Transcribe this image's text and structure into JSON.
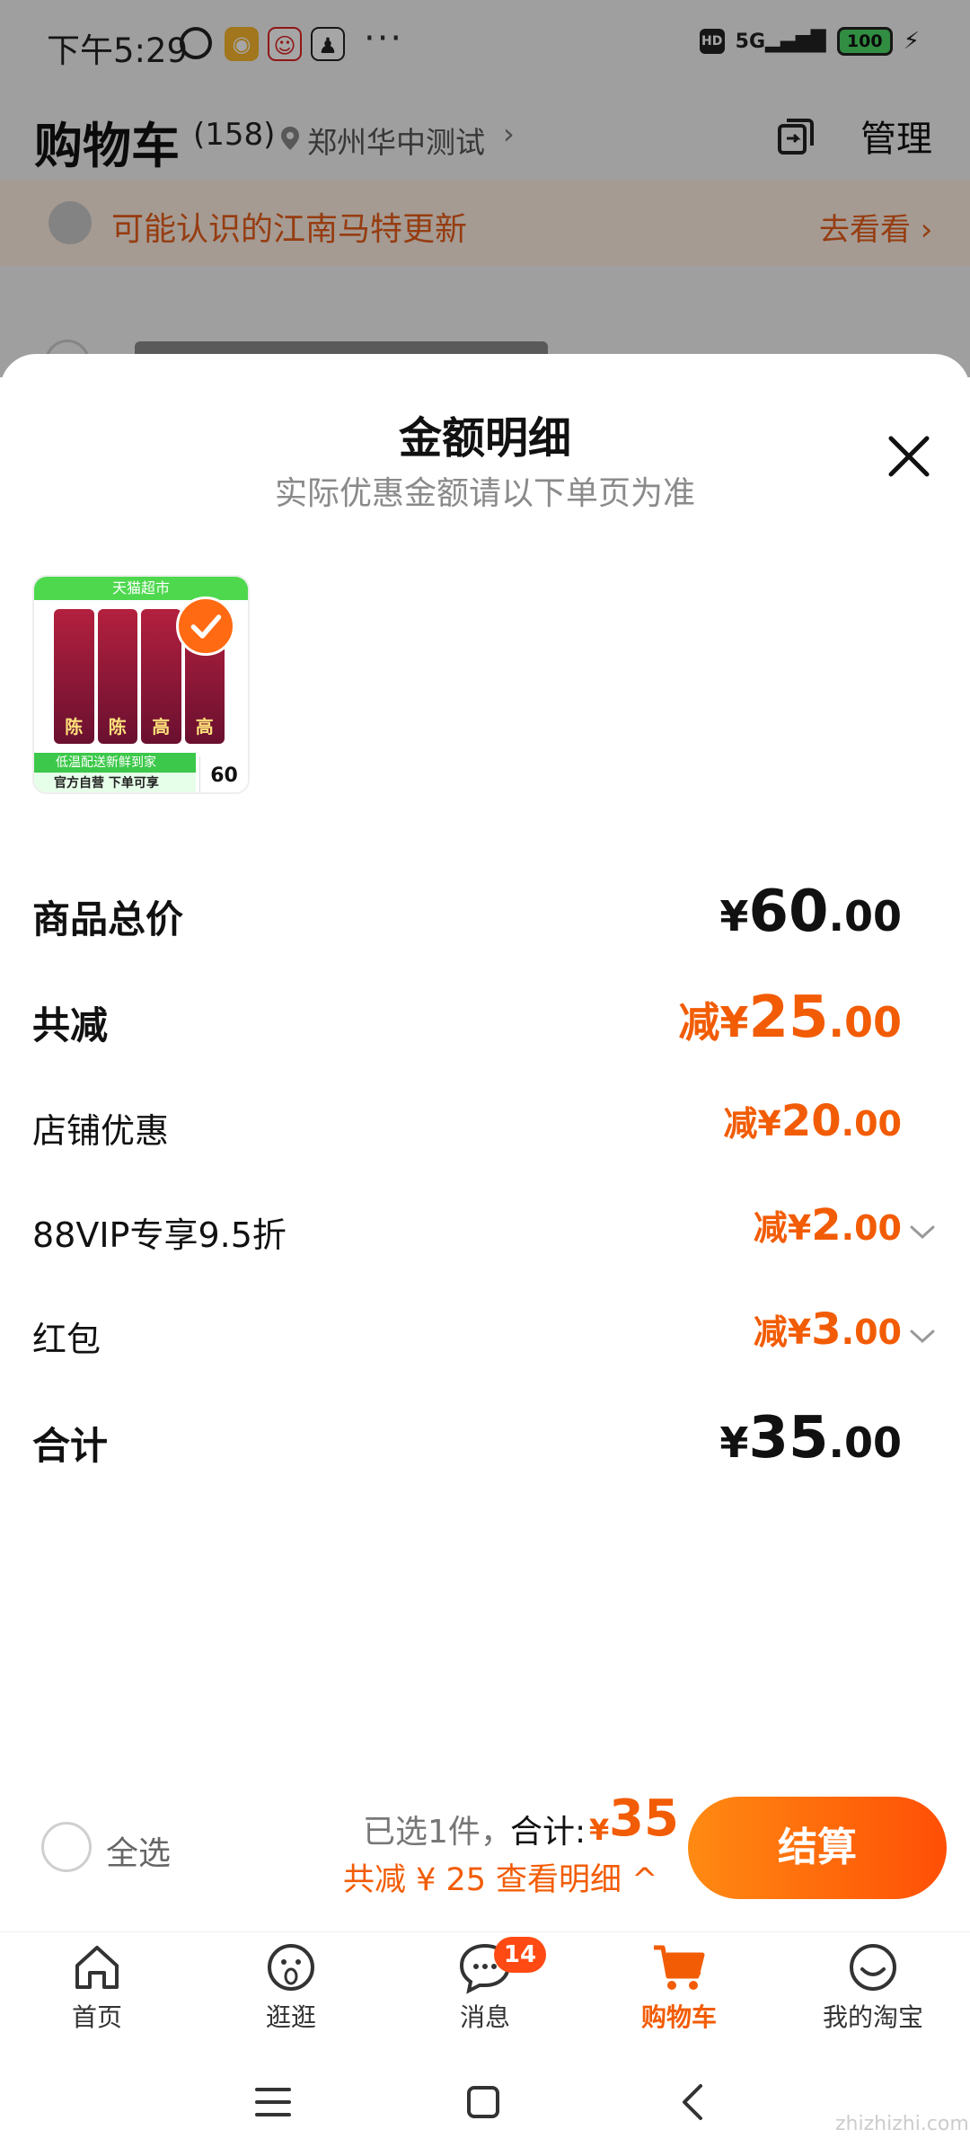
{
  "status_bar": {
    "time": "下午5:29",
    "network": "5G",
    "battery": "100",
    "icons": [
      "alarm-icon",
      "weibo-icon",
      "santa-icon",
      "qq-icon",
      "more-dots-icon",
      "hd-icon",
      "signal-icon",
      "battery-icon",
      "charging-icon"
    ]
  },
  "cart_header": {
    "title": "购物车",
    "count": "(158)",
    "location": "郑州华中测试",
    "manage": "管理"
  },
  "promo": {
    "text": "可能认识的江南马特更新",
    "link": "去看看"
  },
  "sheet": {
    "title": "金额明细",
    "subtitle": "实际优惠金额请以下单页为准",
    "product": {
      "banner_top": "天猫超市",
      "can_labels": [
        "陈",
        "陈",
        "高",
        "高"
      ],
      "banner_1": "低温配送新鲜到家",
      "banner_2": "官方自营 下单可享",
      "price_tag": "60"
    },
    "rows": [
      {
        "label": "商品总价",
        "prefix": "",
        "currency": "¥",
        "int": "60",
        "dec": ".00"
      },
      {
        "label": "共减",
        "prefix": "减",
        "currency": "¥",
        "int": "25",
        "dec": ".00"
      },
      {
        "label": "店铺优惠",
        "prefix": "减",
        "currency": "¥",
        "int": "20",
        "dec": ".00"
      },
      {
        "label": "88VIP专享9.5折",
        "prefix": "减",
        "currency": "¥",
        "int": "2",
        "dec": ".00"
      },
      {
        "label": "红包",
        "prefix": "减",
        "currency": "¥",
        "int": "3",
        "dec": ".00"
      },
      {
        "label": "合计",
        "prefix": "",
        "currency": "¥",
        "int": "35",
        "dec": ".00"
      }
    ]
  },
  "checkout": {
    "select_all": "全选",
    "selected": "已选1件，",
    "total_label": "合计:",
    "total_currency": "¥",
    "total_value": "35",
    "saved": "共减 ¥ 25",
    "detail_link": "查看明细 ^",
    "button": "结算"
  },
  "tabs": [
    {
      "label": "首页",
      "icon": "home-icon"
    },
    {
      "label": "逛逛",
      "icon": "discover-icon"
    },
    {
      "label": "消息",
      "icon": "message-icon",
      "badge": "14"
    },
    {
      "label": "购物车",
      "icon": "cart-icon",
      "active": true
    },
    {
      "label": "我的淘宝",
      "icon": "profile-icon"
    }
  ],
  "watermark": "zhizhizhi.com",
  "colors": {
    "accent": "#f25c05",
    "checkout_gradient_start": "#ff8a12",
    "checkout_gradient_end": "#ff4f06",
    "promo_bg": "#fdeee2"
  }
}
